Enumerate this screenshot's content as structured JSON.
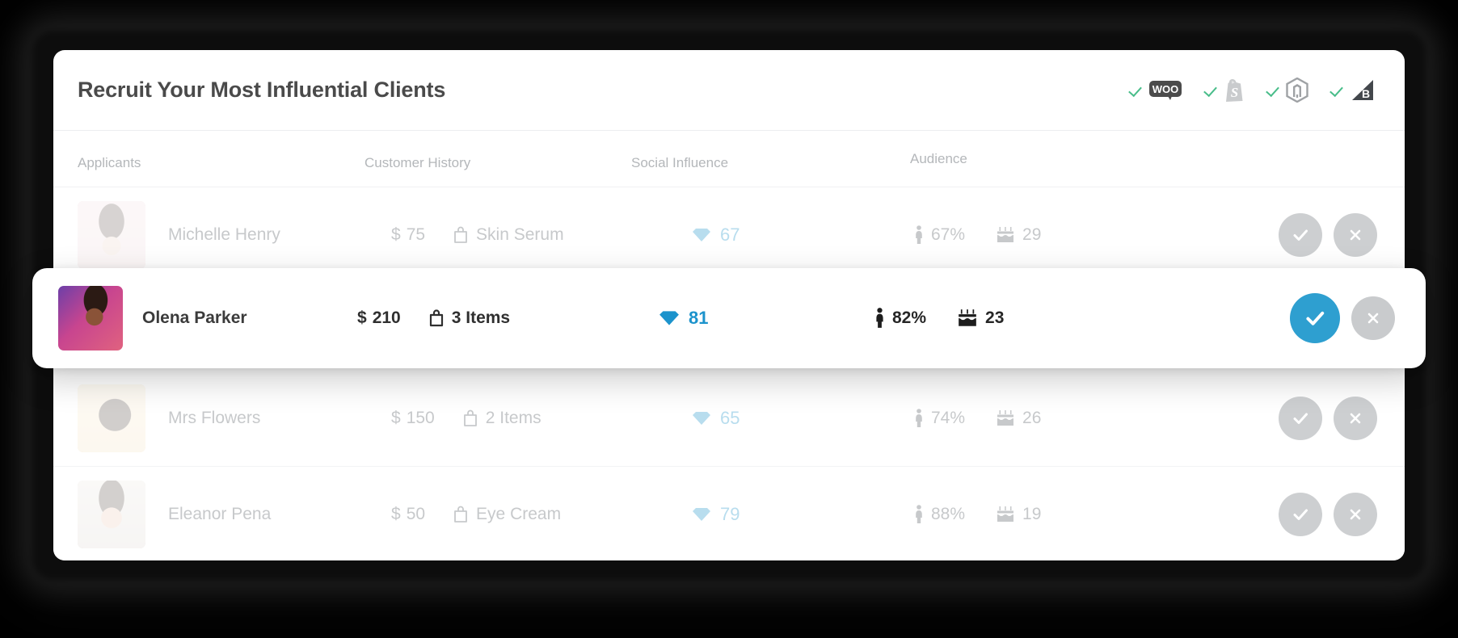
{
  "header": {
    "title": "Recruit Your Most Influential Clients",
    "integrations": [
      {
        "name": "WooCommerce",
        "icon": "woocommerce-icon",
        "connected": true,
        "check": "✓"
      },
      {
        "name": "Shopify",
        "icon": "shopify-icon",
        "connected": true,
        "check": "✓"
      },
      {
        "name": "Magento",
        "icon": "magento-icon",
        "connected": true,
        "check": "✓"
      },
      {
        "name": "BigCommerce",
        "icon": "bigcommerce-icon",
        "connected": true,
        "check": "✓"
      }
    ]
  },
  "table": {
    "columns": {
      "applicants": "Applicants",
      "history": "Customer History",
      "social": "Social Influence",
      "audience": "Audience"
    },
    "rows": [
      {
        "name": "Michelle Henry",
        "currency": "$",
        "price": "75",
        "product": "Skin Serum",
        "score": "67",
        "female_pct": "67%",
        "age": "29",
        "selected": false,
        "accept_label": "✓",
        "reject_label": "✕"
      },
      {
        "name": "Olena Parker",
        "currency": "$",
        "price": "210",
        "product": "3 Items",
        "score": "81",
        "female_pct": "82%",
        "age": "23",
        "selected": true,
        "accept_label": "✓",
        "reject_label": "✕"
      },
      {
        "name": "Mrs Flowers",
        "currency": "$",
        "price": "150",
        "product": "2 Items",
        "score": "65",
        "female_pct": "74%",
        "age": "26",
        "selected": false,
        "accept_label": "✓",
        "reject_label": "✕"
      },
      {
        "name": "Eleanor Pena",
        "currency": "$",
        "price": "50",
        "product": "Eye Cream",
        "score": "79",
        "female_pct": "88%",
        "age": "19",
        "selected": false,
        "accept_label": "✓",
        "reject_label": "✕"
      }
    ]
  },
  "icons": {
    "bag": "shopping-bag-icon",
    "diamond": "diamond-icon",
    "female": "female-figure-icon",
    "cake": "birthday-cake-icon",
    "check": "check-icon",
    "close": "close-icon"
  },
  "colors": {
    "accent": "#2e9fd0",
    "check_green": "#49bd8a",
    "muted": "#c7c9cb",
    "text": "#4a4a4a",
    "background": "#000000",
    "card": "#ffffff"
  }
}
